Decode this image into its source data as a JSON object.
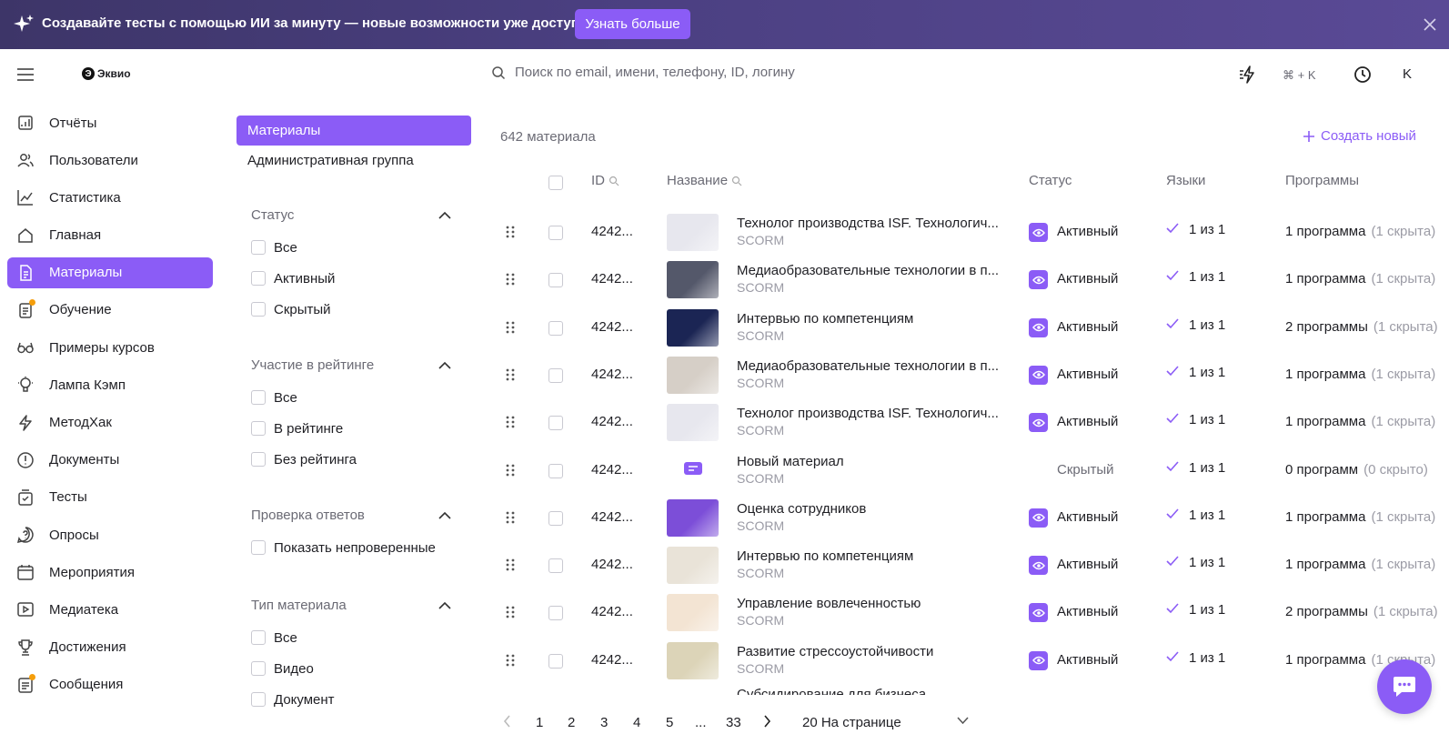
{
  "banner": {
    "text": "Создавайте тесты с помощью ИИ за минуту — новые возможности уже доступны!",
    "button": "Узнать больше"
  },
  "header": {
    "logo": "Эквио",
    "logo_mark": "Э",
    "search_placeholder": "Поиск по email, имени, телефону, ID, логину",
    "shortcut": "⌘ + K",
    "avatar": "K"
  },
  "sidebar": {
    "items": [
      {
        "label": "Отчёты",
        "icon": "reports-icon"
      },
      {
        "label": "Пользователи",
        "icon": "users-icon"
      },
      {
        "label": "Статистика",
        "icon": "chart-icon"
      },
      {
        "label": "Главная",
        "icon": "home-icon"
      },
      {
        "label": "Материалы",
        "icon": "document-icon",
        "active": true
      },
      {
        "label": "Обучение",
        "icon": "learning-icon",
        "badge": true
      },
      {
        "label": "Примеры курсов",
        "icon": "glasses-icon"
      },
      {
        "label": "Лампа Кэмп",
        "icon": "bulb-icon"
      },
      {
        "label": "МетодХак",
        "icon": "lightning-icon"
      },
      {
        "label": "Документы",
        "icon": "info-icon"
      },
      {
        "label": "Тесты",
        "icon": "tests-icon"
      },
      {
        "label": "Опросы",
        "icon": "question-icon"
      },
      {
        "label": "Мероприятия",
        "icon": "calendar-icon"
      },
      {
        "label": "Медиатека",
        "icon": "play-icon"
      },
      {
        "label": "Достижения",
        "icon": "trophy-icon"
      },
      {
        "label": "Сообщения",
        "icon": "messages-icon",
        "badge": true
      }
    ]
  },
  "filters": {
    "tabs": [
      "Материалы",
      "Административная группа"
    ],
    "status": {
      "title": "Статус",
      "options": [
        "Все",
        "Активный",
        "Скрытый"
      ]
    },
    "rating": {
      "title": "Участие в рейтинге",
      "options": [
        "Все",
        "В рейтинге",
        "Без рейтинга"
      ]
    },
    "review": {
      "title": "Проверка ответов",
      "options": [
        "Показать непроверенные"
      ]
    },
    "type": {
      "title": "Тип материала",
      "options": [
        "Все",
        "Видео",
        "Документ"
      ]
    }
  },
  "content": {
    "count": "642 материала",
    "create_label": "Создать новый",
    "columns": {
      "id": "ID",
      "name": "Название",
      "status": "Статус",
      "languages": "Языки",
      "programs": "Программы"
    },
    "rows": [
      {
        "id": "4242...",
        "title": "Технолог производства ISF. Технологич...",
        "type": "SCORM",
        "status": "Активный",
        "lang": "1 из 1",
        "programs": "1 программа",
        "hidden": "(1 скрыта)",
        "thumb": "#e7e7ee"
      },
      {
        "id": "4242...",
        "title": "Медиаобразовательные технологии в п...",
        "type": "SCORM",
        "status": "Активный",
        "lang": "1 из 1",
        "programs": "1 программа",
        "hidden": "(1 скрыта)",
        "thumb": "#54586a"
      },
      {
        "id": "4242...",
        "title": "Интервью по компетенциям",
        "type": "SCORM",
        "status": "Активный",
        "lang": "1 из 1",
        "programs": "2 программы",
        "hidden": "(1 скрыта)",
        "thumb": "#1b2554"
      },
      {
        "id": "4242...",
        "title": "Медиаобразовательные технологии в п...",
        "type": "SCORM",
        "status": "Активный",
        "lang": "1 из 1",
        "programs": "1 программа",
        "hidden": "(1 скрыта)",
        "thumb": "#d6cfc7"
      },
      {
        "id": "4242...",
        "title": "Технолог производства ISF. Технологич...",
        "type": "SCORM",
        "status": "Активный",
        "lang": "1 из 1",
        "programs": "1 программа",
        "hidden": "(1 скрыта)",
        "thumb": "#e7e7ee"
      },
      {
        "id": "4242...",
        "title": "Новый материал",
        "type": "SCORM",
        "status": "Скрытый",
        "lang": "1 из 1",
        "programs": "0 программ",
        "hidden": "(0 скрыто)",
        "thumb": "none"
      },
      {
        "id": "4242...",
        "title": "Оценка сотрудников",
        "type": "SCORM",
        "status": "Активный",
        "lang": "1 из 1",
        "programs": "1 программа",
        "hidden": "(1 скрыта)",
        "thumb": "#7c4ed8"
      },
      {
        "id": "4242...",
        "title": "Интервью по компетенциям",
        "type": "SCORM",
        "status": "Активный",
        "lang": "1 из 1",
        "programs": "1 программа",
        "hidden": "(1 скрыта)",
        "thumb": "#e9e3d8"
      },
      {
        "id": "4242...",
        "title": "Управление вовлеченностью",
        "type": "SCORM",
        "status": "Активный",
        "lang": "1 из 1",
        "programs": "2 программы",
        "hidden": "(1 скрыта)",
        "thumb": "#f3e4d3"
      },
      {
        "id": "4242...",
        "title": "Развитие стрессоустойчивости",
        "type": "SCORM",
        "status": "Активный",
        "lang": "1 из 1",
        "programs": "1 программа",
        "hidden": "(1 скрыта)",
        "thumb": "#dcd4b8"
      }
    ],
    "partial_row_title": "Субсидирование для бизнеса"
  },
  "pager": {
    "pages": [
      "1",
      "2",
      "3",
      "4",
      "5",
      "...",
      "33"
    ],
    "per_page": "20 На странице"
  },
  "colors": {
    "accent": "#8b5cf6",
    "banner": "#4a3f80",
    "badge": "#f59e0b"
  }
}
